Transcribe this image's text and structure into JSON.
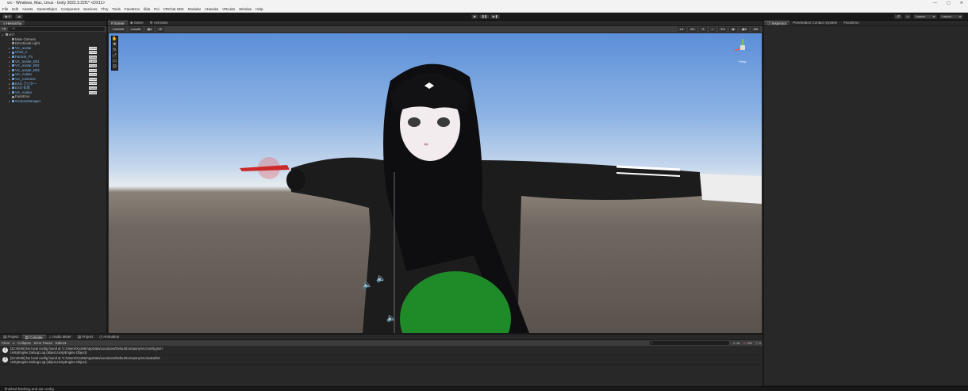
{
  "window": {
    "title": "vrc - Windows, Mac, Linux - Unity 2022.3.22f1* <DX11>",
    "controls": [
      "—",
      "▢",
      "✕"
    ]
  },
  "menu": [
    "File",
    "Edit",
    "Assets",
    "GameObject",
    "Component",
    "Services",
    "Thry",
    "Tools",
    "FaceEmo",
    "lilda",
    "Poi",
    "VRChat SDK",
    "Modular",
    "nHaruka",
    "VRLabs",
    "Window",
    "Help"
  ],
  "toolbar": {
    "account": "K",
    "layers": "Layers",
    "layout": "Layout"
  },
  "hierarchy": {
    "tab": "Hierarchy",
    "search_placeholder": "All",
    "items": [
      {
        "label": "vrc*",
        "indent": 0,
        "prefab": false,
        "badge": ""
      },
      {
        "label": "Main Camera",
        "indent": 1,
        "prefab": false,
        "badge": ""
      },
      {
        "label": "Directional Light",
        "indent": 1,
        "prefab": false,
        "badge": ""
      },
      {
        "label": "Vrc_avatar",
        "indent": 1,
        "prefab": true,
        "badge": "Prefab"
      },
      {
        "label": "Chair_A",
        "indent": 1,
        "prefab": true,
        "badge": "Prefab"
      },
      {
        "label": "Particle_FX",
        "indent": 1,
        "prefab": true,
        "badge": "Prefab"
      },
      {
        "label": "Vrc_avatar_B01",
        "indent": 1,
        "prefab": true,
        "badge": "Prefab"
      },
      {
        "label": "Vrc_avatar_B02",
        "indent": 1,
        "prefab": true,
        "badge": "Prefab"
      },
      {
        "label": "Vrc_avatar_B03",
        "indent": 1,
        "prefab": true,
        "badge": "Prefab"
      },
      {
        "label": "Vrc_Avatar",
        "indent": 1,
        "prefab": true,
        "badge": "Prefab"
      },
      {
        "label": "Vrc_Costume",
        "indent": 1,
        "prefab": true,
        "badge": "Prefab"
      },
      {
        "label": "EXO アバター",
        "indent": 1,
        "prefab": true,
        "badge": "Prefab"
      },
      {
        "label": "EXO 衣装",
        "indent": 1,
        "prefab": true,
        "badge": "Prefab"
      },
      {
        "label": "Vrc_Avatar",
        "indent": 1,
        "prefab": true,
        "badge": "Prefab"
      },
      {
        "label": "FaceEmo",
        "indent": 1,
        "prefab": false,
        "badge": ""
      },
      {
        "label": "GestureManager",
        "indent": 1,
        "prefab": true,
        "badge": ""
      }
    ]
  },
  "scene": {
    "tabs": [
      "Scene",
      "Game",
      "Animator"
    ],
    "active_tab": "Scene",
    "shading": "Center",
    "pivot": "Local",
    "mode_2d": "2D",
    "persp_label": "Persp"
  },
  "inspector": {
    "tabs": [
      "Inspector",
      "Penetration Contact System",
      "FaceEmo"
    ]
  },
  "console": {
    "tabs": [
      "Project",
      "Console",
      "Audio Mixer",
      "Project",
      "Animation"
    ],
    "active_tab": "Console",
    "buttons": [
      "Clear",
      "Collapse",
      "Error Pause",
      "Editor"
    ],
    "warn_count": "16",
    "error_count": "728",
    "info_count": "0",
    "logs": [
      {
        "line1": "[22:49:09] No local config found at 'C:/Users/X1266/AppData/LocalLow/DefaultCompany/vrc/config.json'",
        "line2": "UnityEngine.Debug:Log (object,UnityEngine.Object)"
      },
      {
        "line1": "[22:49:09] No local config found at 'C:/Users/X1266/AppData/LocalLow/DefaultCompany/vrc/avatarlist'",
        "line2": "UnityEngine.Debug:Log (object,UnityEngine.Object)"
      }
    ]
  },
  "status": {
    "message": "finished fetching and set config"
  },
  "colors": {
    "accent": "#7cb5e8",
    "panel": "#282828",
    "toolbar": "#3c3c3c"
  }
}
